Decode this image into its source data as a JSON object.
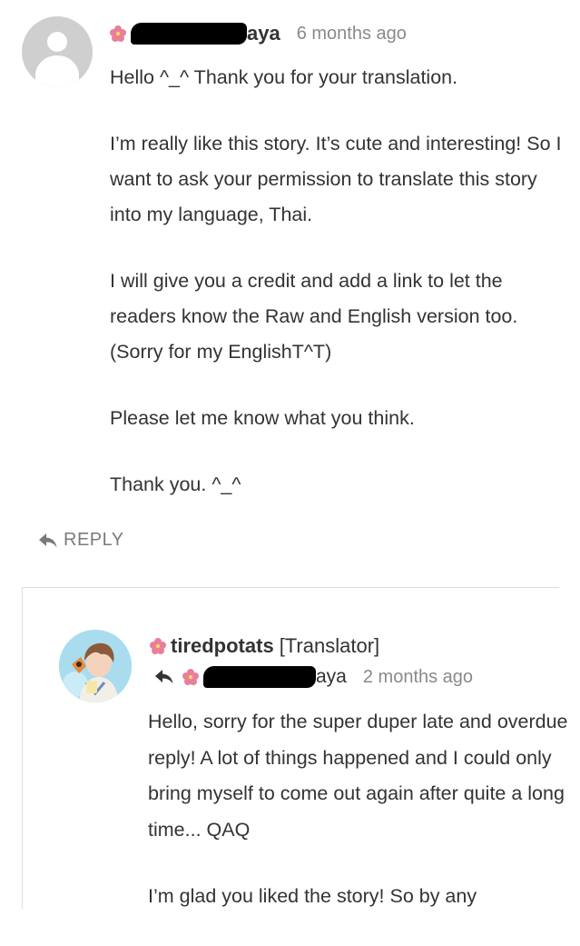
{
  "comment": {
    "author_visible": "aya",
    "time": "6 months ago",
    "paragraphs": [
      "Hello ^_^ Thank you for your translation.",
      "I’m really like this story. It’s cute and interesting! So I want to ask your permission to translate this story into my language, Thai.",
      "I will give you a credit and add a link to let the readers know the Raw and English version too. (Sorry for my EnglishT^T)",
      "Please let me know what you think.",
      "Thank you. ^_^"
    ],
    "reply_label": "REPLY"
  },
  "reply_comment": {
    "author": "tiredpotats",
    "role": "[Translator]",
    "in_reply_to_visible": "aya",
    "time": "2 months ago",
    "paragraphs": [
      "Hello, sorry for the super duper late and overdue reply! A lot of things happened and I could only bring myself to come out again after quite a long time... QAQ",
      "I’m glad you liked the story! So by any"
    ]
  },
  "colors": {
    "text": "#333333",
    "meta": "#8a8a8a",
    "avatar_placeholder": "#cfcfcf",
    "flower": "#e87f9a"
  },
  "icons": [
    "user-placeholder-icon",
    "flower-icon",
    "reply-arrow-icon"
  ]
}
